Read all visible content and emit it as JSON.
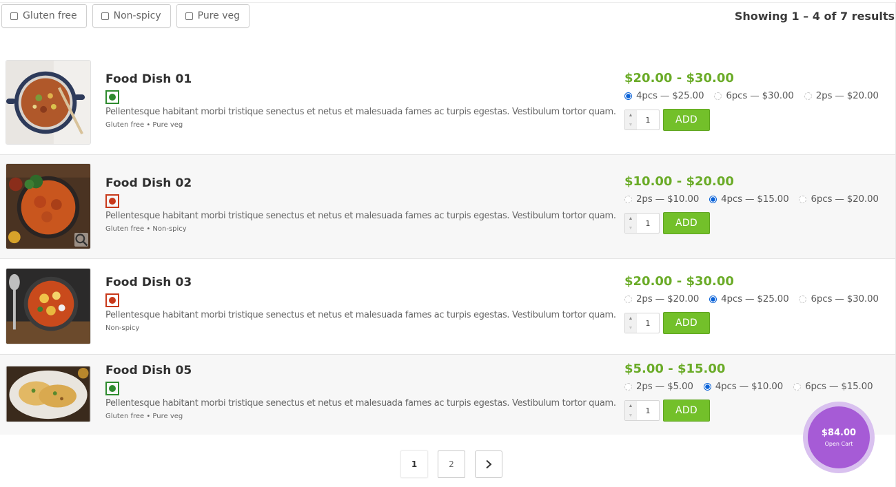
{
  "filters": [
    {
      "label": "Gluten free"
    },
    {
      "label": "Non-spicy"
    },
    {
      "label": "Pure veg"
    }
  ],
  "results_count": "Showing 1 – 4 of 7 results",
  "products": [
    {
      "title": "Food Dish 01",
      "diet": "veg",
      "description": "Pellentesque habitant morbi tristique senectus et netus et malesuada fames ac turpis egestas. Vestibulum tortor quam.",
      "tags": "Gluten free • Pure veg",
      "price": "$20.00 - $30.00",
      "variants": [
        {
          "label": "4pcs — $25.00",
          "selected": true
        },
        {
          "label": "6pcs — $30.00",
          "selected": false
        },
        {
          "label": "2ps — $20.00",
          "selected": false
        }
      ],
      "quantity": "1",
      "add_label": "ADD"
    },
    {
      "title": "Food Dish 02",
      "diet": "nonveg",
      "description": "Pellentesque habitant morbi tristique senectus et netus et malesuada fames ac turpis egestas. Vestibulum tortor quam.",
      "tags": "Gluten free • Non-spicy",
      "price": "$10.00 - $20.00",
      "variants": [
        {
          "label": "2ps — $10.00",
          "selected": false
        },
        {
          "label": "4pcs — $15.00",
          "selected": true
        },
        {
          "label": "6pcs — $20.00",
          "selected": false
        }
      ],
      "quantity": "1",
      "add_label": "ADD"
    },
    {
      "title": "Food Dish 03",
      "diet": "nonveg",
      "description": "Pellentesque habitant morbi tristique senectus et netus et malesuada fames ac turpis egestas. Vestibulum tortor quam.",
      "tags": "Non-spicy",
      "price": "$20.00 - $30.00",
      "variants": [
        {
          "label": "2ps — $20.00",
          "selected": false
        },
        {
          "label": "4pcs — $25.00",
          "selected": true
        },
        {
          "label": "6pcs — $30.00",
          "selected": false
        }
      ],
      "quantity": "1",
      "add_label": "ADD"
    },
    {
      "title": "Food Dish 05",
      "diet": "veg",
      "description": "Pellentesque habitant morbi tristique senectus et netus et malesuada fames ac turpis egestas. Vestibulum tortor quam.",
      "tags": "Gluten free • Pure veg",
      "price": "$5.00 - $15.00",
      "variants": [
        {
          "label": "2ps — $5.00",
          "selected": false
        },
        {
          "label": "4pcs — $10.00",
          "selected": true
        },
        {
          "label": "6pcs — $15.00",
          "selected": false
        }
      ],
      "quantity": "1",
      "add_label": "ADD"
    }
  ],
  "pagination": {
    "pages": [
      "1",
      "2"
    ],
    "current": "1",
    "next_icon": "chevron-right-icon"
  },
  "cart": {
    "total": "$84.00",
    "label": "Open Cart"
  },
  "colors": {
    "price": "#6aab27",
    "add_button": "#73c02a",
    "cart": "#a65bd6",
    "veg": "#2e8b2e",
    "nonveg": "#c8391b",
    "radio_selected": "#0b63d8"
  }
}
